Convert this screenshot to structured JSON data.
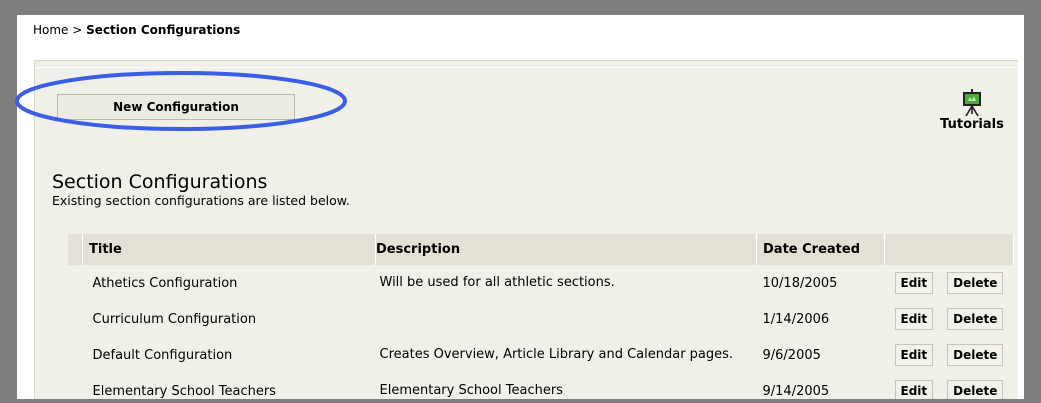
{
  "breadcrumb": {
    "home": "Home",
    "separator": ">",
    "current": "Section Configurations"
  },
  "toolbar": {
    "new_configuration_label": "New Configuration"
  },
  "tutorials": {
    "label": "Tutorials",
    "icon": "presentation-board-icon"
  },
  "highlight": {
    "color": "#3a5ee6"
  },
  "section": {
    "title": "Section Configurations",
    "subtitle": "Existing section configurations are listed below."
  },
  "table": {
    "headers": {
      "title": "Title",
      "description": "Description",
      "date": "Date Created"
    },
    "rows": [
      {
        "title": "Athetics Configuration",
        "description": "Will be used for all athletic sections.",
        "date": "10/18/2005",
        "edit": "Edit",
        "delete": "Delete"
      },
      {
        "title": "Curriculum Configuration",
        "description": "",
        "date": "1/14/2006",
        "edit": "Edit",
        "delete": "Delete"
      },
      {
        "title": "Default Configuration",
        "description": "Creates Overview, Article Library and Calendar pages.",
        "date": "9/6/2005",
        "edit": "Edit",
        "delete": "Delete"
      },
      {
        "title": "Elementary School Teachers",
        "description": "Elementary School Teachers",
        "date": "9/14/2005",
        "edit": "Edit",
        "delete": "Delete"
      }
    ]
  }
}
